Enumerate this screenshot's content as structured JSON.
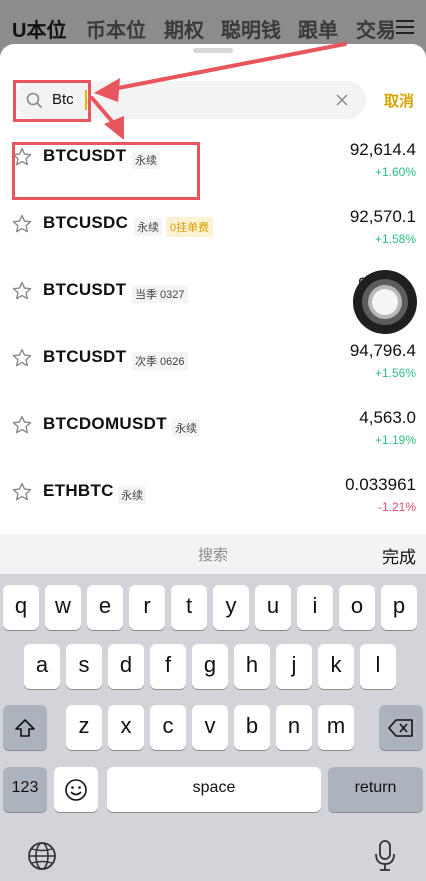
{
  "background_tabs": [
    "U本位",
    "币本位",
    "期权",
    "聪明钱",
    "跟单",
    "交易"
  ],
  "search": {
    "value": "Btc",
    "cancel_label": "取消"
  },
  "results": [
    {
      "symbol": "BTCUSDT",
      "tag": "永续",
      "badge": "",
      "price": "92,614.4",
      "change": "+1.60%",
      "direction": "up"
    },
    {
      "symbol": "BTCUSDC",
      "tag": "永续",
      "badge": "0挂单费",
      "price": "92,570.1",
      "change": "+1.58%",
      "direction": "up"
    },
    {
      "symbol": "BTCUSDT",
      "tag": "当季 0327",
      "badge": "",
      "price": "93",
      "change": "",
      "direction": "up"
    },
    {
      "symbol": "BTCUSDT",
      "tag": "次季 0626",
      "badge": "",
      "price": "94,796.4",
      "change": "+1.56%",
      "direction": "up"
    },
    {
      "symbol": "BTCDOMUSDT",
      "tag": "永续",
      "badge": "",
      "price": "4,563.0",
      "change": "+1.19%",
      "direction": "up"
    },
    {
      "symbol": "ETHBTC",
      "tag": "永续",
      "badge": "",
      "price": "0.033961",
      "change": "-1.21%",
      "direction": "down"
    }
  ],
  "keyboard": {
    "toolbar_label": "搜索",
    "done_label": "完成",
    "row1": [
      "q",
      "w",
      "e",
      "r",
      "t",
      "y",
      "u",
      "i",
      "o",
      "p"
    ],
    "row2": [
      "a",
      "s",
      "d",
      "f",
      "g",
      "h",
      "j",
      "k",
      "l"
    ],
    "row3": [
      "z",
      "x",
      "c",
      "v",
      "b",
      "n",
      "m"
    ],
    "numbers_label": "123",
    "space_label": "space",
    "return_label": "return"
  },
  "colors": {
    "accent": "#d7a400",
    "up": "#2ebd85",
    "down": "#e24b6a",
    "annotation": "#e8555c"
  },
  "icons": [
    "hamburger-menu-icon",
    "search-icon",
    "clear-icon",
    "star-icon",
    "shift-icon",
    "backspace-icon",
    "emoji-icon",
    "globe-icon",
    "microphone-icon"
  ]
}
